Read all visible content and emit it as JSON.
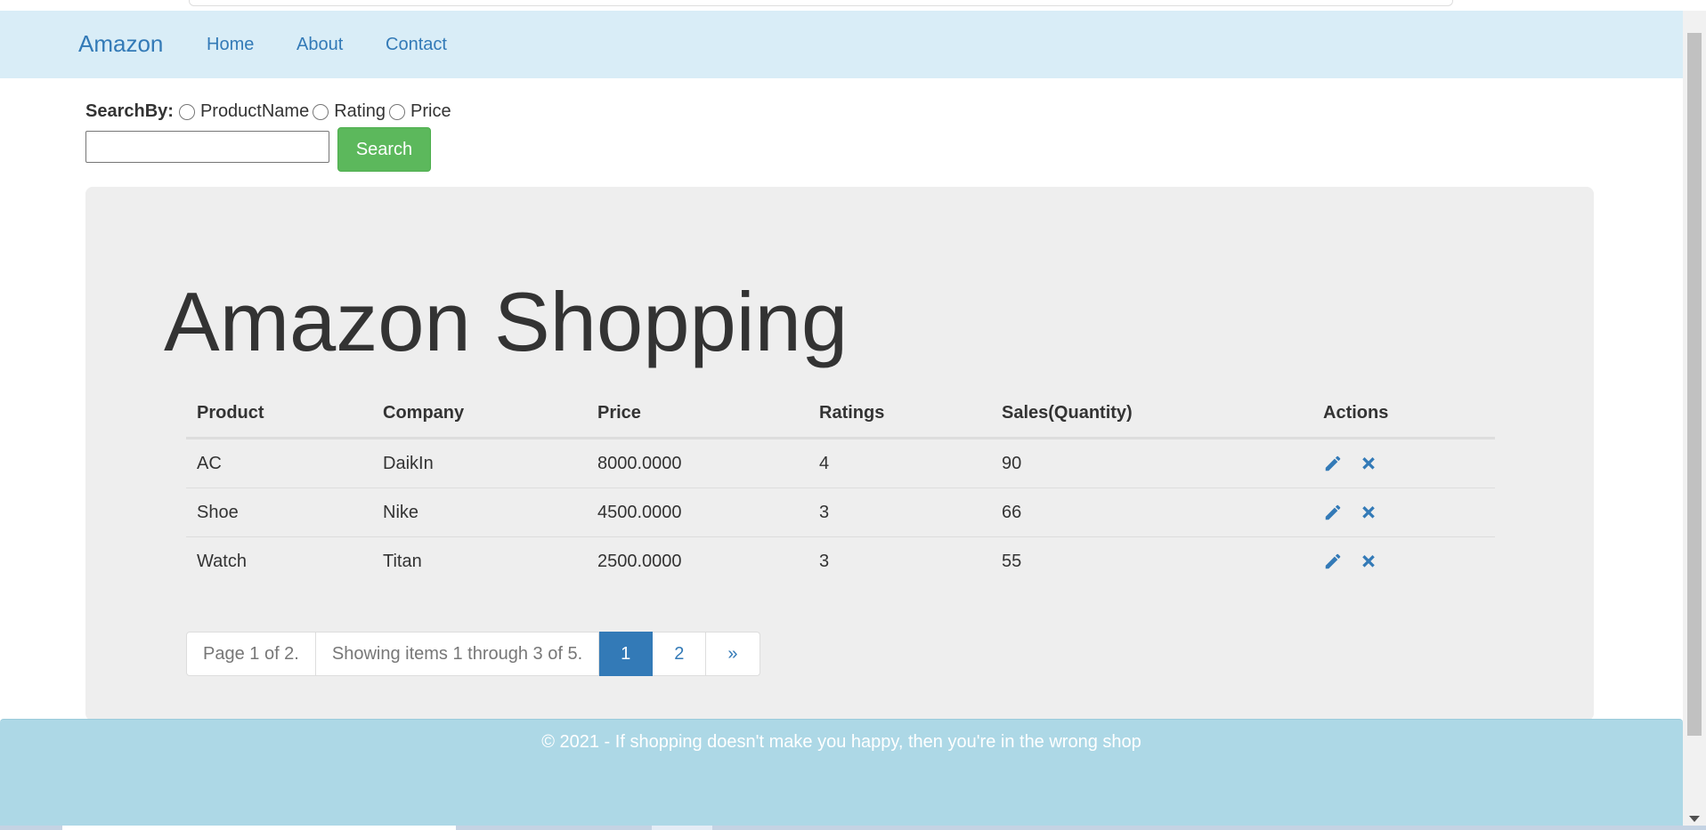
{
  "navbar": {
    "brand": "Amazon",
    "links": [
      "Home",
      "About",
      "Contact"
    ]
  },
  "search": {
    "label": "SearchBy:",
    "options": [
      "ProductName",
      "Rating",
      "Price"
    ],
    "value": "",
    "button_label": "Search"
  },
  "main": {
    "title": "Amazon Shopping",
    "table": {
      "headers": [
        "Product",
        "Company",
        "Price",
        "Ratings",
        "Sales(Quantity)",
        "Actions"
      ],
      "rows": [
        [
          "AC",
          "DaikIn",
          "8000.0000",
          "4",
          "90"
        ],
        [
          "Shoe",
          "Nike",
          "4500.0000",
          "3",
          "66"
        ],
        [
          "Watch",
          "Titan",
          "2500.0000",
          "3",
          "55"
        ]
      ]
    },
    "pagination": {
      "page_info": "Page 1 of 2.",
      "items_info": "Showing items 1 through 3 of 5.",
      "pages": [
        "1",
        "2"
      ],
      "next": "»"
    }
  },
  "footer": {
    "text": "© 2021 - If shopping doesn't make you happy, then you're in the wrong shop"
  },
  "icons": {
    "edit": "pencil-icon",
    "delete": "x-icon"
  },
  "colors": {
    "navbar_bg": "#d9edf7",
    "link": "#337ab7",
    "search_button": "#5cb85c",
    "jumbotron_bg": "#eeeeee",
    "footer_bg": "#add8e6",
    "active_page": "#337ab7"
  }
}
